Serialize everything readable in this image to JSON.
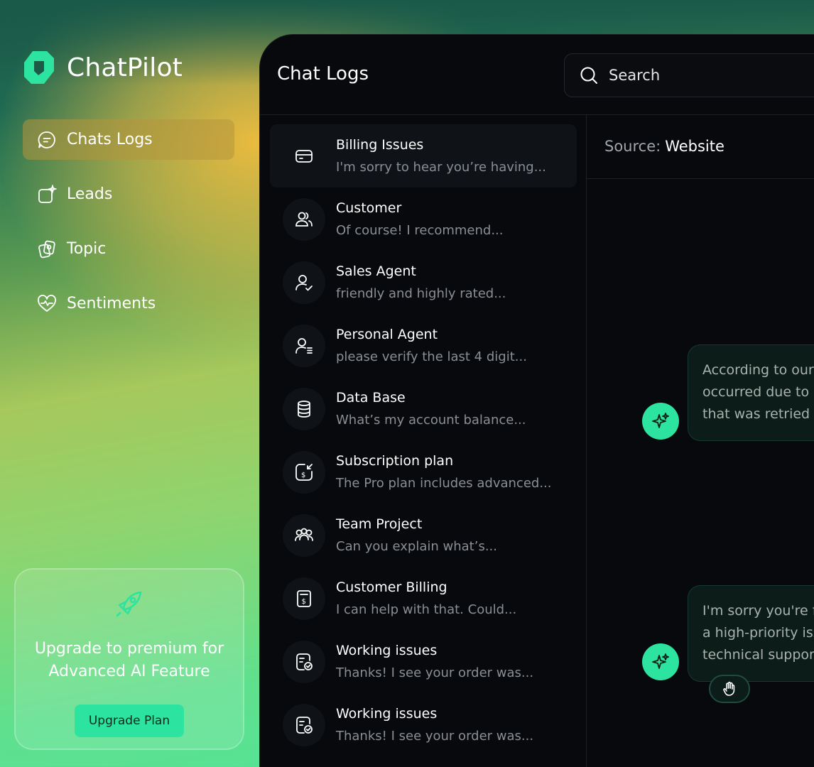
{
  "app": {
    "name": "ChatPilot",
    "brand_color": "#2de3a0"
  },
  "sidebar": {
    "items": [
      {
        "label": "Chats Logs",
        "icon": "chat-bubble-icon",
        "active": true
      },
      {
        "label": "Leads",
        "icon": "leads-sparkle-icon"
      },
      {
        "label": "Topic",
        "icon": "topic-cards-icon"
      },
      {
        "label": "Sentiments",
        "icon": "heart-pulse-icon"
      }
    ]
  },
  "upgrade": {
    "line1": "Upgrade to premium for",
    "line2": "Advanced AI Feature",
    "button": "Upgrade Plan",
    "icon": "rocket-icon"
  },
  "main": {
    "title": "Chat Logs",
    "search": {
      "placeholder": "Search"
    },
    "source": {
      "label": "Source:",
      "value": "Website"
    },
    "chats": [
      {
        "title": "Billing Issues",
        "preview": "I'm sorry to hear you’re having...",
        "icon": "card-icon",
        "active": true
      },
      {
        "title": "Customer",
        "preview": "Of course! I recommend...",
        "icon": "users-icon"
      },
      {
        "title": "Sales Agent",
        "preview": "friendly and highly rated...",
        "icon": "user-check-icon"
      },
      {
        "title": "Personal Agent",
        "preview": "please verify the last 4 digit...",
        "icon": "user-list-icon"
      },
      {
        "title": "Data Base",
        "preview": "What’s my account balance...",
        "icon": "database-icon"
      },
      {
        "title": "Subscription plan",
        "preview": "The Pro plan includes advanced...",
        "icon": "dollar-refresh-icon"
      },
      {
        "title": "Team Project",
        "preview": "Can you explain what’s...",
        "icon": "team-icon"
      },
      {
        "title": "Customer Billing",
        "preview": "I can help with that. Could...",
        "icon": "receipt-icon"
      },
      {
        "title": "Working issues",
        "preview": "Thanks! I see your order was...",
        "icon": "task-check-icon"
      },
      {
        "title": "Working issues",
        "preview": "Thanks! I see your order was...",
        "icon": "task-check-icon"
      }
    ],
    "messages": [
      {
        "lines": [
          "According to our r",
          "occurred due to a",
          "that was retried s"
        ]
      },
      {
        "lines": [
          "I'm sorry you're fa",
          "a high-priority issu",
          "technical support"
        ]
      }
    ]
  }
}
